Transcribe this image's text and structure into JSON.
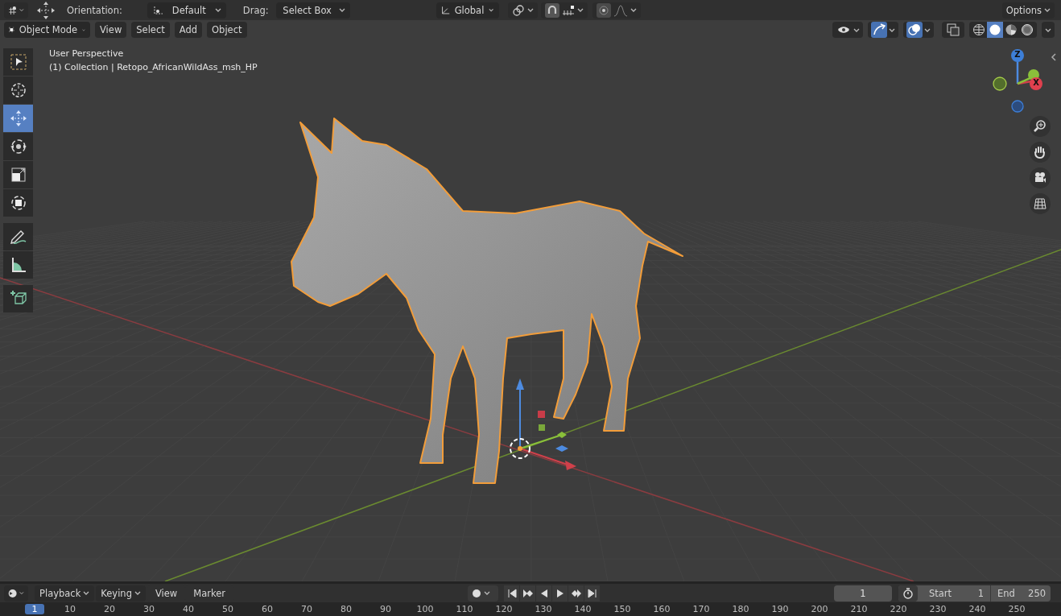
{
  "header": {
    "orientation_label": "Orientation:",
    "orientation": "Default",
    "drag_label": "Drag:",
    "drag": "Select Box",
    "transform_orientation": "Global",
    "options": "Options"
  },
  "mode_bar": {
    "mode": "Object Mode",
    "menus": [
      "View",
      "Select",
      "Add",
      "Object"
    ]
  },
  "view_toggles": [
    {
      "kind": "visibility",
      "on": false
    },
    {
      "kind": "gizmo",
      "on": true
    },
    {
      "kind": "overlay",
      "on": true
    },
    {
      "kind": "xray",
      "on": false
    }
  ],
  "shading": [
    {
      "kind": "wireframe",
      "selected": false
    },
    {
      "kind": "solid",
      "selected": true
    },
    {
      "kind": "material",
      "selected": false
    },
    {
      "kind": "rendered",
      "selected": false
    }
  ],
  "tools": [
    {
      "kind": "select",
      "selected": false
    },
    {
      "kind": "cursor",
      "selected": false
    },
    {
      "kind": "move",
      "selected": true
    },
    {
      "kind": "rotate",
      "selected": false
    },
    {
      "kind": "scale",
      "selected": false
    },
    {
      "kind": "transform",
      "selected": false
    },
    {
      "kind": "annotate",
      "selected": false
    },
    {
      "kind": "measure",
      "selected": false
    },
    {
      "kind": "add-cube",
      "selected": false
    }
  ],
  "viewport_info": {
    "view": "User Perspective",
    "object": "(1) Collection | Retopo_AfricanWildAss_msh_HP"
  },
  "nav_gizmo": {
    "axes": [
      {
        "label": "Z"
      },
      {
        "label": "X"
      }
    ]
  },
  "timeline": {
    "menus": [
      "Playback",
      "Keying",
      "View",
      "Marker"
    ],
    "current_frame": "1",
    "start_label": "Start",
    "start": "1",
    "end_label": "End",
    "end": "250",
    "ruler": [
      {
        "label": "1",
        "selected": true
      },
      {
        "label": "10",
        "selected": false
      },
      {
        "label": "20",
        "selected": false
      },
      {
        "label": "30",
        "selected": false
      },
      {
        "label": "40",
        "selected": false
      },
      {
        "label": "50",
        "selected": false
      },
      {
        "label": "60",
        "selected": false
      },
      {
        "label": "70",
        "selected": false
      },
      {
        "label": "80",
        "selected": false
      },
      {
        "label": "90",
        "selected": false
      },
      {
        "label": "100",
        "selected": false
      },
      {
        "label": "110",
        "selected": false
      },
      {
        "label": "120",
        "selected": false
      },
      {
        "label": "130",
        "selected": false
      },
      {
        "label": "140",
        "selected": false
      },
      {
        "label": "150",
        "selected": false
      },
      {
        "label": "160",
        "selected": false
      },
      {
        "label": "170",
        "selected": false
      },
      {
        "label": "180",
        "selected": false
      },
      {
        "label": "190",
        "selected": false
      },
      {
        "label": "200",
        "selected": false
      },
      {
        "label": "210",
        "selected": false
      },
      {
        "label": "220",
        "selected": false
      },
      {
        "label": "230",
        "selected": false
      },
      {
        "label": "240",
        "selected": false
      },
      {
        "label": "250",
        "selected": false
      }
    ]
  }
}
